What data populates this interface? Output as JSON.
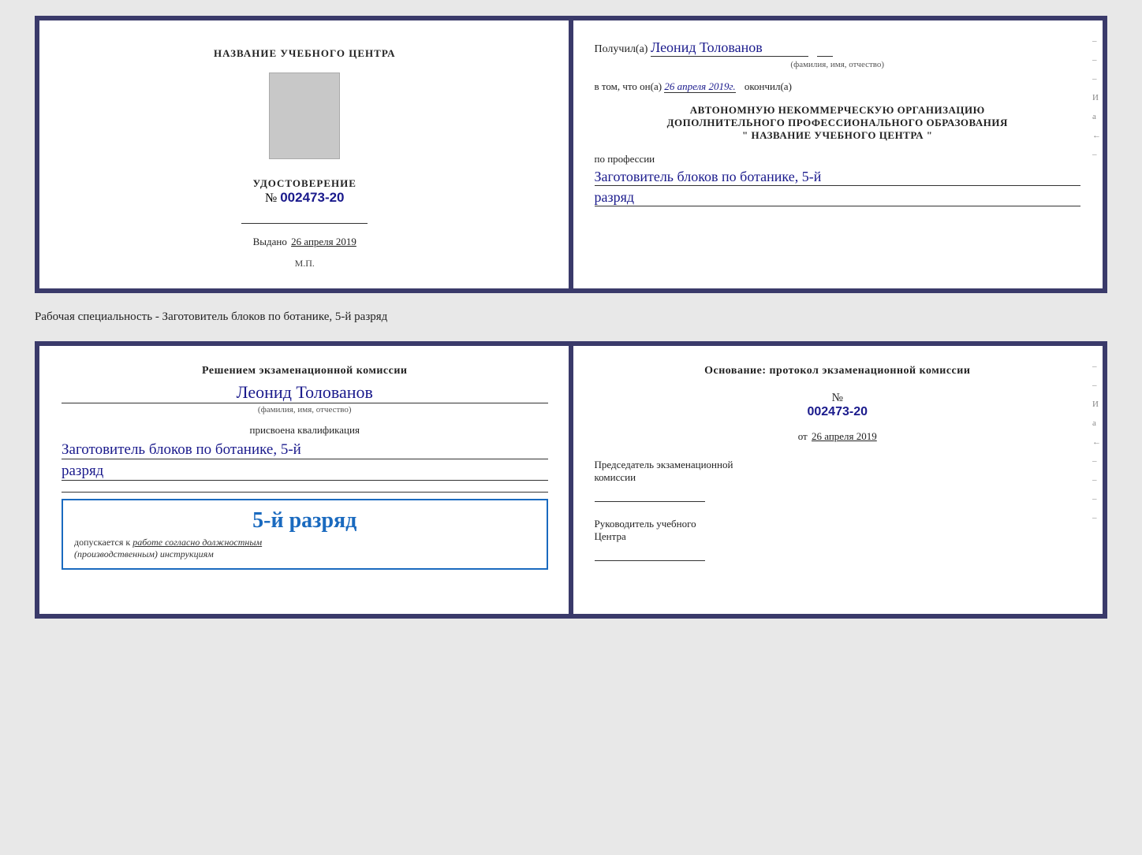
{
  "top_doc": {
    "left": {
      "center_title": "НАЗВАНИЕ УЧЕБНОГО ЦЕНТРА",
      "cert_label": "УДОСТОВЕРЕНИЕ",
      "cert_number_prefix": "№",
      "cert_number": "002473-20",
      "issued_label": "Выдано",
      "issued_date": "26 апреля 2019",
      "stamp_label": "М.П."
    },
    "right": {
      "received_prefix": "Получил(а)",
      "recipient_name": "Леонид Толованов",
      "name_caption": "(фамилия, имя, отчество)",
      "confirmed_prefix": "в том, что он(а)",
      "confirmed_date": "26 апреля 2019г.",
      "confirmed_suffix": "окончил(а)",
      "org_line1": "АВТОНОМНУЮ НЕКОММЕРЧЕСКУЮ ОРГАНИЗАЦИЮ",
      "org_line2": "ДОПОЛНИТЕЛЬНОГО ПРОФЕССИОНАЛЬНОГО ОБРАЗОВАНИЯ",
      "org_line3": "\"  НАЗВАНИЕ УЧЕБНОГО ЦЕНТРА  \"",
      "profession_label": "по профессии",
      "profession_value": "Заготовитель блоков по ботанике, 5-й",
      "rank_value": "разряд"
    }
  },
  "specialty_label": "Рабочая специальность - Заготовитель блоков по ботанике, 5-й разряд",
  "bottom_doc": {
    "left": {
      "commission_prefix": "Решением экзаменационной комиссии",
      "commission_name": "Леонид Толованов",
      "name_caption": "(фамилия, имя, отчество)",
      "assigned_label": "присвоена квалификация",
      "assigned_profession": "Заготовитель блоков по ботанике, 5-й",
      "assigned_rank": "разряд",
      "stamp_rank": "5-й разряд",
      "admitted_label": "допускается к",
      "admitted_text": "работе согласно должностным",
      "admitted_text2": "(производственным) инструкциям"
    },
    "right": {
      "basis_title": "Основание: протокол экзаменационной комиссии",
      "proto_prefix": "№",
      "proto_number": "002473-20",
      "from_label": "от",
      "from_date": "26 апреля 2019",
      "chairman_title": "Председатель экзаменационной",
      "chairman_title2": "комиссии",
      "head_title": "Руководитель учебного",
      "head_title2": "Центра"
    }
  },
  "side_marks": [
    "–",
    "–",
    "И",
    "а",
    "←",
    "–",
    "–",
    "–",
    "–"
  ]
}
